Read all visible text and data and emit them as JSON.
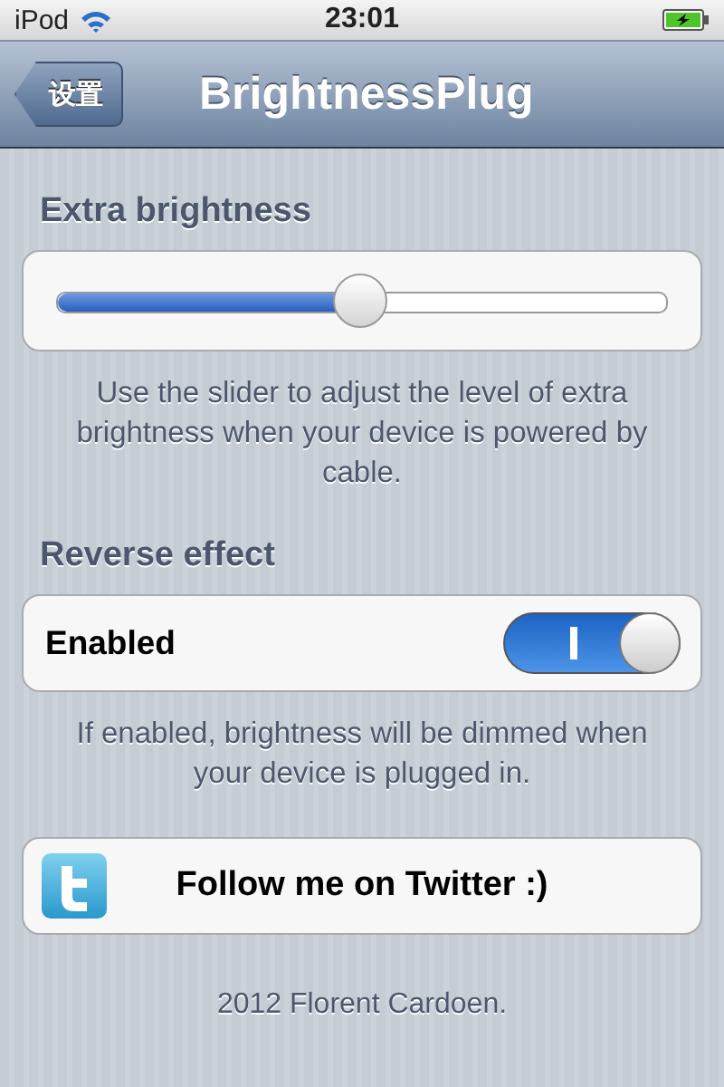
{
  "status_bar": {
    "carrier": "iPod",
    "time": "23:01",
    "charging": true
  },
  "nav_bar": {
    "back_button": "设置",
    "title": "BrightnessPlug"
  },
  "sections": [
    {
      "kind": "slider",
      "header": "Extra brightness",
      "level": 0.5,
      "footer": "Use the slider to adjust the level of extra brightness when your device is powered by cable."
    },
    {
      "kind": "switch",
      "header": "Reverse effect",
      "label": "Enabled",
      "on": true,
      "footer": "If enabled, brightness will be dimmed when your device is plugged in."
    },
    {
      "kind": "button",
      "label": "Follow me on Twitter :)"
    }
  ],
  "credit": "2012 Florent Cardoen."
}
